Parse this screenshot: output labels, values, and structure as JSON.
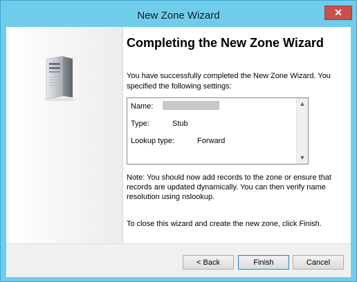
{
  "window": {
    "title": "New Zone Wizard",
    "close_glyph": "✕"
  },
  "page": {
    "heading": "Completing the New Zone Wizard",
    "intro": "You have successfully completed the New Zone Wizard. You specified the following settings:",
    "settings": {
      "name_label": "Name:",
      "type_label": "Type:",
      "type_value": "Stub",
      "lookup_label": "Lookup type:",
      "lookup_value": "Forward"
    },
    "note": "Note: You should now add records to the zone or ensure that records are updated dynamically. You can then verify name resolution using nslookup.",
    "finish_instruction": "To close this wizard and create the new zone, click Finish."
  },
  "buttons": {
    "back": "< Back",
    "finish": "Finish",
    "cancel": "Cancel"
  },
  "icons": {
    "side": "server-icon",
    "scroll_up": "chevron-up-icon",
    "scroll_down": "chevron-down-icon"
  },
  "colors": {
    "title_bar": "#6fcdeb",
    "close_button": "#c7504b"
  }
}
